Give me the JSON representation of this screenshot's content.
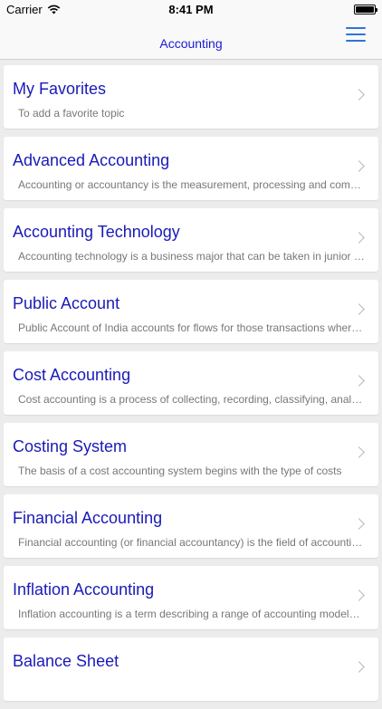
{
  "status_bar": {
    "carrier": "Carrier",
    "time": "8:41 PM",
    "wifi_icon": "wifi-icon",
    "battery_icon": "battery-icon"
  },
  "nav": {
    "title": "Accounting",
    "menu_icon": "hamburger-menu-icon",
    "accent_color": "#1a1ad6"
  },
  "items": [
    {
      "title": "My Favorites",
      "subtitle": "To add a favorite topic"
    },
    {
      "title": "Advanced Accounting",
      "subtitle": "Accounting or accountancy is the measurement, processing and communication of financial information about economic entities"
    },
    {
      "title": "Accounting Technology",
      "subtitle": "Accounting technology is a business major that can be taken in junior colleges"
    },
    {
      "title": "Public Account",
      "subtitle": "Public Account of India accounts for flows for those transactions where the government is merely acting as a banker"
    },
    {
      "title": "Cost Accounting",
      "subtitle": "Cost accounting is a process of collecting, recording, classifying, analyzing, summarizing, and allocating costs"
    },
    {
      "title": "Costing System",
      "subtitle": "The basis of a cost accounting system begins with the type of costs"
    },
    {
      "title": "Financial Accounting",
      "subtitle": "Financial accounting (or financial accountancy) is the field of accounting concerned with the summary, analysis and reporting of financial transactions"
    },
    {
      "title": "Inflation Accounting",
      "subtitle": "Inflation accounting is a term describing a range of accounting models designed to correct problems arising from historical cost accounting"
    },
    {
      "title": "Balance Sheet",
      "subtitle": ""
    }
  ]
}
